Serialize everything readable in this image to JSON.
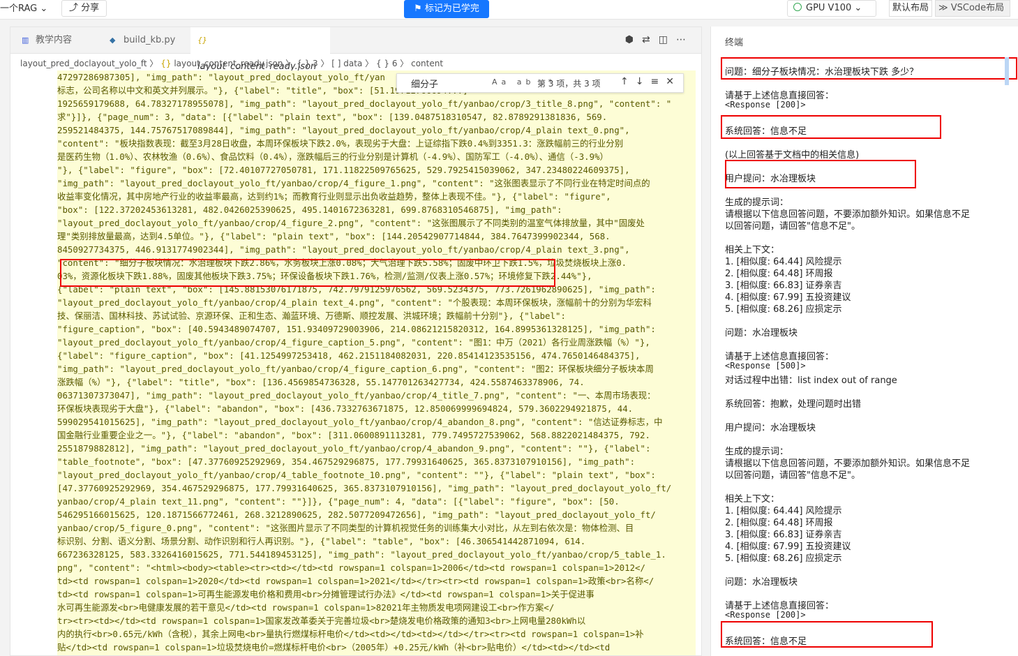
{
  "topbar": {
    "project": "一个RAG",
    "share": "分享",
    "mark_learned": "标记为已学完",
    "gpu": "GPU V100",
    "default_layout": "默认布局",
    "vscode_layout": "VSCode布局"
  },
  "tabs": [
    {
      "label": "教学内容",
      "icon": "book-icon"
    },
    {
      "label": "build_kb.py",
      "icon": "python-icon"
    },
    {
      "label": "layout_content_ready.json",
      "icon": "json-icon"
    }
  ],
  "breadcrumb": {
    "folder": "layout_pred_doclayout_yolo_ft",
    "file": "layout_content_ready.json",
    "path": "{ } 3 〉 [ ] data 〉 { } 6 〉 content"
  },
  "find": {
    "query": "细分子",
    "opts": "Aa ab .*",
    "count": "第 3 项，共 3 项"
  },
  "code_lines": [
    "47297286987305], \"img_path\": \"layout_pred_doclayout_yolo_ft/yan",
    "标志，公司名称以中文和英文并列展示。\"}, {\"label\": \"title\", \"box\": [51.19712766694...]",
    "1925659179688, 64.78327178955078], \"img_path\": \"layout_pred_doclayout_yolo_ft/yanbao/crop/3_title_8.png\", \"content\": \"",
    "求\"}]}, {\"page_num\": 3, \"data\": [{\"label\": \"plain text\", \"box\": [139.0487518310547, 82.8789291381836, 569.",
    "259521484375, 144.75767517089844], \"img_path\": \"layout_pred_doclayout_yolo_ft/yanbao/crop/4_plain text_0.png\",",
    "\"content\": \"板块指数表现：截至3月28日收盘，本周环保板块下跌2.0%，表现劣于大盘：上证综指下跌0.4%到3351.3：涨跌幅前三的行业分别",
    "是医药生物（1.0%）、农林牧渔（0.6%）、食品饮料（0.4%），涨跌幅后三的行业分别是计算机（-4.9%）、国防军工（-4.0%）、通信（-3.9%）",
    "\"}, {\"label\": \"figure\", \"box\": [72.40107727050781, 171.11822509765625, 529.7925415039062, 347.23480224609375],",
    "\"img_path\": \"layout_pred_doclayout_yolo_ft/yanbao/crop/4_figure_1.png\", \"content\": \"这张图表显示了不同行业在特定时间点的",
    "收益率变化情况，其中房地产行业的收益率最高，达到约1%；而教育行业则显示出负收益趋势，整体上表现不佳。\"}, {\"label\": \"figure\",",
    "\"box\": [122.37202453613281, 482.0426025390625, 495.1401672363281, 699.8768310546875], \"img_path\":",
    "\"layout_pred_doclayout_yolo_ft/yanbao/crop/4_figure_2.png\", \"content\": \"这张图展示了不同类别的温室气体排放量，其中\"固废处",
    "理\"类别排放量最高，达到4.5单位。\"}, {\"label\": \"plain text\", \"box\": [144.20542907714844, 384.7647399902344, 568.",
    "8450927734375, 446.9131774902344], \"img_path\": \"layout_pred_doclayout_yolo_ft/yanbao/crop/4_plain text_3.png\",",
    "\"content\": \"细分子板块情况：水治理板块下跌2.86%，水务板块上涨0.08%；大气治理下跌5.58%；固废中环卫下跌1.5%，垃圾焚烧板块上涨0.",
    "03%，资源化板块下跌1.88%，固废其他板块下跌3.75%；环保设备板块下跌1.76%，检测/监测/仪表上涨0.57%；环境修复下跌2.44%\"},",
    "{\"label\": \"plain text\", \"box\": [145.88153076171875, 742.7979125976562, 569.5234375, 773.7261962890625], \"img_path\":",
    "\"layout_pred_doclayout_yolo_ft/yanbao/crop/4_plain text_4.png\", \"content\": \"个股表现：本周环保板块，涨幅前十的分别为华宏科",
    "技、保丽洁、国林科技、苏试试验、京源环保、正和生态、瀚蓝环境、万德斯、顺控发展、洪城环境；跌幅前十分别\"}, {\"label\":",
    "\"figure_caption\", \"box\": [40.5943489074707, 151.93409729003906, 214.08621215820312, 164.8995361328125], \"img_path\":",
    "\"layout_pred_doclayout_yolo_ft/yanbao/crop/4_figure_caption_5.png\", \"content\": \"图1：中万（2021）各行业周涨跌幅（%）\"},",
    "{\"label\": \"figure_caption\", \"box\": [41.1254997253418, 462.2151184082031, 220.85414123535156, 474.7650146484375],",
    "\"img_path\": \"layout_pred_doclayout_yolo_ft/yanbao/crop/4_figure_caption_6.png\", \"content\": \"图2：环保板块细分子板块本周",
    "涨跌幅（%）\"}, {\"label\": \"title\", \"box\": [136.4569854736328, 55.147701263427734, 424.5587463378906, 74.",
    "06371307373047], \"img_path\": \"layout_pred_doclayout_yolo_ft/yanbao/crop/4_title_7.png\", \"content\": \"一、本周市场表现：",
    "环保板块表现劣于大盘\"}, {\"label\": \"abandon\", \"box\": [436.7332763671875, 12.850069999694824, 579.3602294921875, 44.",
    "599029541015625], \"img_path\": \"layout_pred_doclayout_yolo_ft/yanbao/crop/4_abandon_8.png\", \"content\": \"信达证券标志，中",
    "国金融行业重要企业之一。\"}, {\"label\": \"abandon\", \"box\": [311.0600891113281, 779.7495727539062, 568.8822021484375, 792.",
    "2551879882812], \"img_path\": \"layout_pred_doclayout_yolo_ft/yanbao/crop/4_abandon_9.png\", \"content\": \"\"}, {\"label\":",
    "\"table_footnote\", \"box\": [47.37760925292969, 354.467529296875, 177.79931640625, 365.8373107910156], \"img_path\":",
    "\"layout_pred_doclayout_yolo_ft/yanbao/crop/4_table_footnote_10.png\", \"content\": \"\"}, {\"label\": \"plain text\", \"box\":",
    "[47.37760925292969, 354.467529296875, 177.79931640625, 365.8373107910156], \"img_path\": \"layout_pred_doclayout_yolo_ft/",
    "yanbao/crop/4_plain text_11.png\", \"content\": \"\"}]}, {\"page_num\": 4, \"data\": [{\"label\": \"figure\", \"box\": [50.",
    "546295166015625, 120.1871566772461, 268.3212890625, 282.5077209472656], \"img_path\": \"layout_pred_doclayout_yolo_ft/",
    "yanbao/crop/5_figure_0.png\", \"content\": \"这张图片显示了不同类型的计算机视觉任务的训练集大小对比，从左到右依次是：物体检测、目",
    "标识别、分割、语义分割、场景分割、动作识别和行人再识别。\"}, {\"label\": \"table\", \"box\": [46.306541442871094, 614.",
    "667236328125, 583.3326416015625, 771.544189453125], \"img_path\": \"layout_pred_doclayout_yolo_ft/yanbao/crop/5_table_1.",
    "png\", \"content\": \"<html><body><table><tr><td></td><td rowspan=1 colspan=1>2006</td><td rowspan=1 colspan=1>2012</",
    "td><td rowspan=1 colspan=1>2020</td><td rowspan=1 colspan=1>2021</td></tr><tr><td rowspan=1 colspan=1>政策<br>名称</",
    "td><td rowspan=1 colspan=1>可再生能源发电价格和费用<br>分摊管理试行办法》</td><td rowspan=1 colspan=1>关于促进事",
    "水可再生能源发<br>电健康发展的若干意见</td><td rowspan=1 colspan=1>82021年主物质发电项网建设工<br>作方案</",
    "tr><tr><td></td><td rowspan=1 colspan=1>国家发改革委关于完善垃圾<br>楚烧发电价格政策的通知3<br>上网电量280kWh以",
    "内的执行<br>0.65元/kWh（含税），其余上网电<br>量执行燃煤标杆电价</td><td></td><td></td></tr><tr><td rowspan=1 colspan=1>补",
    "贴</td><td rowspan=1 colspan=1>垃圾焚烧电价=燃煤标杆电价<br>（2005年）+0.25元/kWh（补<br>贴电价）</td><td></td><td"
  ],
  "terminal": {
    "title": "终端",
    "lines": [
      {
        "text": "问题：细分子板块情况：水治理板块下跌 多少？",
        "mono": false
      },
      {
        "text": "请基于上述信息直接回答：",
        "mono": false
      },
      {
        "text": "<Response [200]>",
        "mono": true
      },
      {
        "text": "系统回答：信息不足",
        "mono": false
      },
      {
        "text": "(以上回答基于文档中的相关信息)",
        "mono": false
      },
      {
        "text": "用户提问：水冶理板块",
        "mono": false
      },
      {
        "text": "生成的提示词：",
        "mono": false
      },
      {
        "text": "  请根据以下信息回答问题，不要添加额外知识。如果信息不足",
        "mono": false
      },
      {
        "text": "以回答问题，请回答\"信息不足\"。",
        "mono": false
      },
      {
        "text": "相关上下文：",
        "mono": false
      },
      {
        "text": "1. [相似度: 64.44] 风险提示",
        "mono": false
      },
      {
        "text": "2. [相似度: 64.48] 环周报",
        "mono": false
      },
      {
        "text": "3. [相似度: 66.83] 证券亲吉",
        "mono": false
      },
      {
        "text": "4. [相似度: 67.99] 五投资建议",
        "mono": false
      },
      {
        "text": "5. [相似度: 68.26] 应损定示",
        "mono": false
      },
      {
        "text": "问题：水冶理板块",
        "mono": false
      },
      {
        "text": "请基于上述信息直接回答：",
        "mono": false
      },
      {
        "text": "<Response [500]>",
        "mono": true
      },
      {
        "text": "对话过程中出错：list index out of range",
        "mono": false
      },
      {
        "text": "系统回答：抱歉，处理问题时出错",
        "mono": false
      },
      {
        "text": "用户提问：水冶理板块",
        "mono": false
      },
      {
        "text": "生成的提示词：",
        "mono": false
      },
      {
        "text": "  请根据以下信息回答问题，不要添加额外知识。如果信息不足",
        "mono": false
      },
      {
        "text": "以回答问题，请回答\"信息不足\"。",
        "mono": false
      },
      {
        "text": "相关上下文：",
        "mono": false
      },
      {
        "text": "1. [相似度: 64.44] 风险提示",
        "mono": false
      },
      {
        "text": "2. [相似度: 64.48] 环周报",
        "mono": false
      },
      {
        "text": "3. [相似度: 66.83] 证券亲吉",
        "mono": false
      },
      {
        "text": "4. [相似度: 67.99] 五投资建议",
        "mono": false
      },
      {
        "text": "5. [相似度: 68.26] 应损定示",
        "mono": false
      },
      {
        "text": "问题：水冶理板块",
        "mono": false
      },
      {
        "text": "请基于上述信息直接回答：",
        "mono": false
      },
      {
        "text": "<Response [200]>",
        "mono": true
      },
      {
        "text": "系统回答：信息不足",
        "mono": false
      }
    ]
  },
  "colors": {
    "accent": "#1677ff",
    "highlight_box": "#ee0000",
    "editor_bg": "#fdfdd6"
  }
}
